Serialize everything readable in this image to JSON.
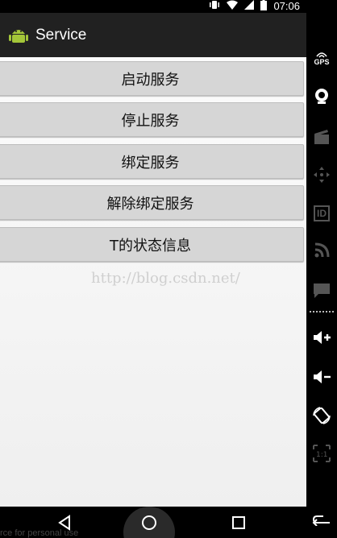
{
  "status": {
    "time": "07:06"
  },
  "app": {
    "title": "Service"
  },
  "buttons": [
    {
      "label": "启动服务"
    },
    {
      "label": "停止服务"
    },
    {
      "label": "绑定服务"
    },
    {
      "label": "解除绑定服务"
    },
    {
      "label": "T的状态信息"
    }
  ],
  "watermark": "http://blog.csdn.net/",
  "nav": {
    "footer_text": "rce for personal use"
  },
  "sidebar": {
    "gps_label": "GPS",
    "id_label": "ID",
    "icons": [
      "gps-icon",
      "camera-icon",
      "clapper-icon",
      "dpad-icon",
      "id-icon",
      "rss-icon",
      "message-icon",
      "volume-up-icon",
      "volume-down-icon",
      "rotate-icon",
      "scale-icon",
      "back-icon"
    ]
  }
}
